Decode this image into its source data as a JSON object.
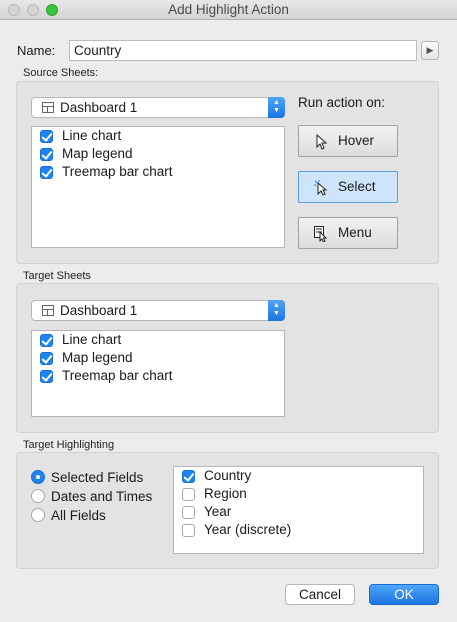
{
  "window": {
    "title": "Add Highlight Action"
  },
  "name": {
    "label": "Name:",
    "value": "Country"
  },
  "source": {
    "section_label": "Source Sheets:",
    "dashboard": "Dashboard 1",
    "sheets": [
      {
        "label": "Line chart",
        "checked": true
      },
      {
        "label": "Map legend",
        "checked": true
      },
      {
        "label": "Treemap bar chart",
        "checked": true
      }
    ],
    "run_label": "Run action on:",
    "actions": [
      {
        "label": "Hover",
        "selected": false,
        "icon": "pointer-icon"
      },
      {
        "label": "Select",
        "selected": true,
        "icon": "click-pointer-icon"
      },
      {
        "label": "Menu",
        "selected": false,
        "icon": "menu-pointer-icon"
      }
    ]
  },
  "target": {
    "section_label": "Target Sheets",
    "dashboard": "Dashboard 1",
    "sheets": [
      {
        "label": "Line chart",
        "checked": true
      },
      {
        "label": "Map legend",
        "checked": true
      },
      {
        "label": "Treemap bar chart",
        "checked": true
      }
    ]
  },
  "highlighting": {
    "section_label": "Target Highlighting",
    "options": [
      {
        "label": "Selected Fields",
        "selected": true
      },
      {
        "label": "Dates and Times",
        "selected": false
      },
      {
        "label": "All Fields",
        "selected": false
      }
    ],
    "fields": [
      {
        "label": "Country",
        "checked": true
      },
      {
        "label": "Region",
        "checked": false
      },
      {
        "label": "Year",
        "checked": false
      },
      {
        "label": "Year (discrete)",
        "checked": false
      }
    ]
  },
  "buttons": {
    "cancel": "Cancel",
    "ok": "OK"
  },
  "colors": {
    "accent": "#1d83f0",
    "selected_button": "#cde4fb"
  }
}
